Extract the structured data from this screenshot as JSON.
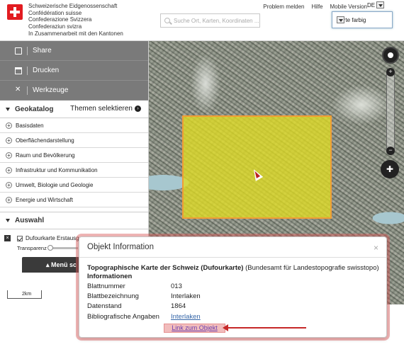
{
  "header": {
    "org_lines": [
      "Schweizerische Eidgenossenschaft",
      "Confédération suisse",
      "Confederazione Svizzera",
      "Confederaziun svizra"
    ],
    "cooperation": "In Zusammenarbeit mit den Kantonen",
    "links": [
      "Problem melden",
      "Hilfe",
      "Mobile Version"
    ],
    "language": "DE",
    "search_placeholder": "Suche Ort, Karten, Koordinaten ...",
    "background_layer": "Karte farbig"
  },
  "sidebar": {
    "buttons": [
      "Share",
      "Drucken",
      "Werkzeuge"
    ],
    "geokatalog": "Geokatalog",
    "themes": "Themen selektieren",
    "categories": [
      "Basisdaten",
      "Oberflächendarstellung",
      "Raum und Bevölkerung",
      "Infrastruktur und Kommunikation",
      "Umwelt, Biologie und Geologie",
      "Energie und Wirtschaft"
    ],
    "auswahl": "Auswahl",
    "layer": "Dufourkarte Erstausg...",
    "transparency_label": "Transparenz",
    "transparency": 0,
    "menu_button": "▴ Menü sc"
  },
  "map": {
    "scale": "2km"
  },
  "popup": {
    "title": "Objekt Information",
    "close": "×",
    "layer_name_bold": "Topographische Karte der Schweiz (Dufourkarte)",
    "layer_source": " (Bundesamt für Landestopografie swisstopo)",
    "info_label": "Informationen",
    "rows": [
      {
        "key": "Blattnummer",
        "value": "013"
      },
      {
        "key": "Blattbezeichnung",
        "value": "Interlaken"
      },
      {
        "key": "Datenstand",
        "value": "1864"
      },
      {
        "key": "Bibliografische Angaben",
        "value": "Interlaken"
      }
    ],
    "link_object": "Link zum Objekt"
  },
  "colors": {
    "accent": "#e21c21",
    "selection": "#e0dc22",
    "selection_border": "#f19d35",
    "link": "#3566a8"
  }
}
